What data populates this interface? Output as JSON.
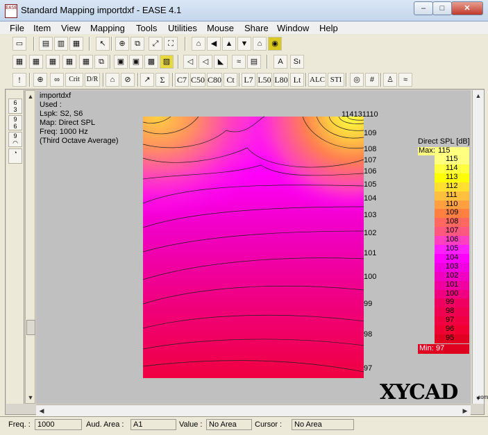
{
  "window": {
    "title": "Standard Mapping importdxf - EASE 4.1",
    "minimize": "–",
    "maximize": "□",
    "close": "✕",
    "app_icon_text": "EASE"
  },
  "menu": [
    "File",
    "Item",
    "View",
    "Mapping",
    "Tools",
    "Utilities",
    "Mouse",
    "Share",
    "Window",
    "Help"
  ],
  "toolbar_text": {
    "c7": "C7",
    "c50": "C50",
    "c80": "C80",
    "ct": "Ct",
    "l7": "L7",
    "l50": "L50",
    "l80": "L80",
    "lt": "Lt",
    "crit": "Crit",
    "dr": "D/R",
    "alc": "ALC",
    "sti": "STI",
    "sigma": "Σ",
    "excl": "!"
  },
  "info": {
    "name": "importdxf",
    "used": "Used :",
    "lspk": "Lspk: S2, S6",
    "map": "Map: Direct SPL",
    "freq": "Freq: 1000 Hz",
    "avg": "(Third Octave Average)"
  },
  "contour_labels": {
    "top": "114131110",
    "right": [
      "109",
      "108",
      "107",
      "106",
      "105",
      "104",
      "103",
      "102",
      "101",
      "100",
      "99",
      "98",
      "97"
    ]
  },
  "legend": {
    "title": "Direct SPL [dB]",
    "max_label": "Max:",
    "max_value": "115",
    "min_label": "Min:",
    "min_value": "97",
    "levels": [
      {
        "value": "115",
        "color": "#ffff80"
      },
      {
        "value": "114",
        "color": "#ffff40"
      },
      {
        "value": "113",
        "color": "#ffff00"
      },
      {
        "value": "112",
        "color": "#ffe030"
      },
      {
        "value": "111",
        "color": "#ffc040"
      },
      {
        "value": "110",
        "color": "#ffa040"
      },
      {
        "value": "109",
        "color": "#ff8040"
      },
      {
        "value": "108",
        "color": "#ff6860"
      },
      {
        "value": "107",
        "color": "#ff5880"
      },
      {
        "value": "106",
        "color": "#ff40c0"
      },
      {
        "value": "105",
        "color": "#ff20ff"
      },
      {
        "value": "104",
        "color": "#ff00ff"
      },
      {
        "value": "103",
        "color": "#f000e0"
      },
      {
        "value": "102",
        "color": "#f000c0"
      },
      {
        "value": "101",
        "color": "#f000a0"
      },
      {
        "value": "100",
        "color": "#f00080"
      },
      {
        "value": "99",
        "color": "#f00060"
      },
      {
        "value": "98",
        "color": "#f00050"
      },
      {
        "value": "97",
        "color": "#f00040"
      },
      {
        "value": "96",
        "color": "#f00030"
      },
      {
        "value": "95",
        "color": "#e00020"
      }
    ]
  },
  "status": {
    "freq_label": "Freq. :",
    "freq_value": "1000",
    "aud_label": "Aud. Area :",
    "aud_value": "A1",
    "value_label": "Value :",
    "value_value": "No Area",
    "cursor_label": "Cursor :",
    "cursor_value": "No Area"
  },
  "watermark": {
    "text": "XYCAD",
    "sub": ".com"
  }
}
